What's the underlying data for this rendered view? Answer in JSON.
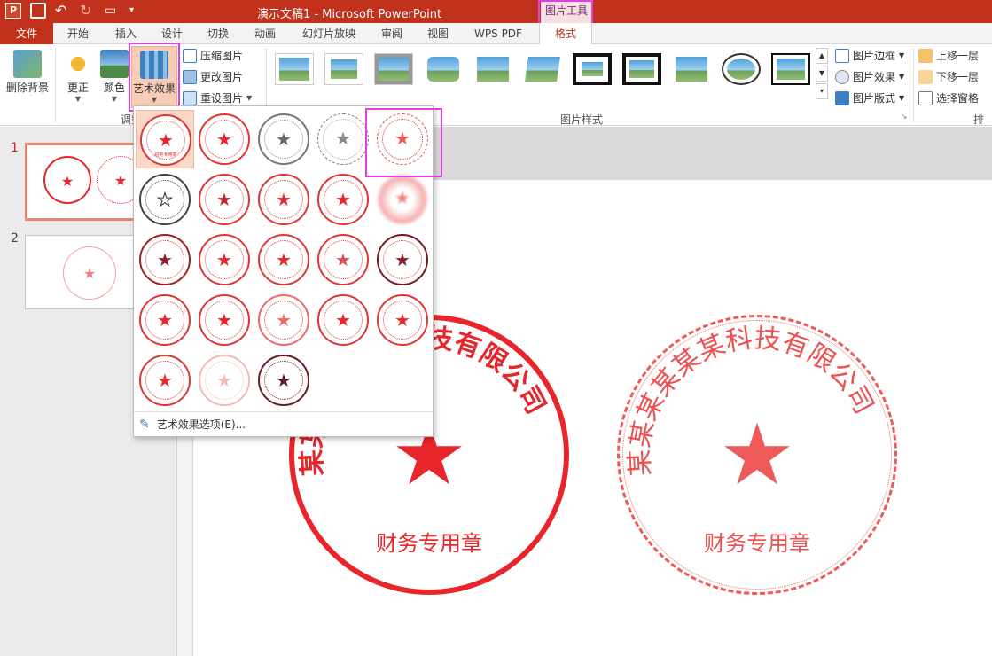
{
  "title_bar": {
    "doc_title": "演示文稿1 -  Microsoft PowerPoint",
    "context_group": "图片工具"
  },
  "tabs": [
    "文件",
    "开始",
    "插入",
    "设计",
    "切换",
    "动画",
    "幻灯片放映",
    "审阅",
    "视图",
    "WPS PDF",
    "格式"
  ],
  "ribbon": {
    "remove_bg": "删除背景",
    "corrections": "更正",
    "color": "颜色",
    "artistic": "艺术效果",
    "compress": "压缩图片",
    "change": "更改图片",
    "reset": "重设图片",
    "adjust_group": "调整",
    "styles_group": "图片样式",
    "border": "图片边框",
    "effects": "图片效果",
    "layout": "图片版式",
    "bring_forward": "上移一层",
    "send_backward": "下移一层",
    "selection_pane": "选择窗格",
    "arrange_group": "排列"
  },
  "slides": [
    {
      "number": "1"
    },
    {
      "number": "2"
    }
  ],
  "seal": {
    "company": "某某某某某某科技有限公司",
    "dept": "财务专用章",
    "thumb_sub_1": "财务专用章",
    "thumb_sub_2": "财务专用章"
  },
  "gallery": {
    "options_label": "艺术效果选项(E)...",
    "thumb_sub": "财务专用章"
  },
  "colors": {
    "accent": "#c2311c",
    "seal_red": "#e8252b",
    "highlight": "#e040e0"
  }
}
